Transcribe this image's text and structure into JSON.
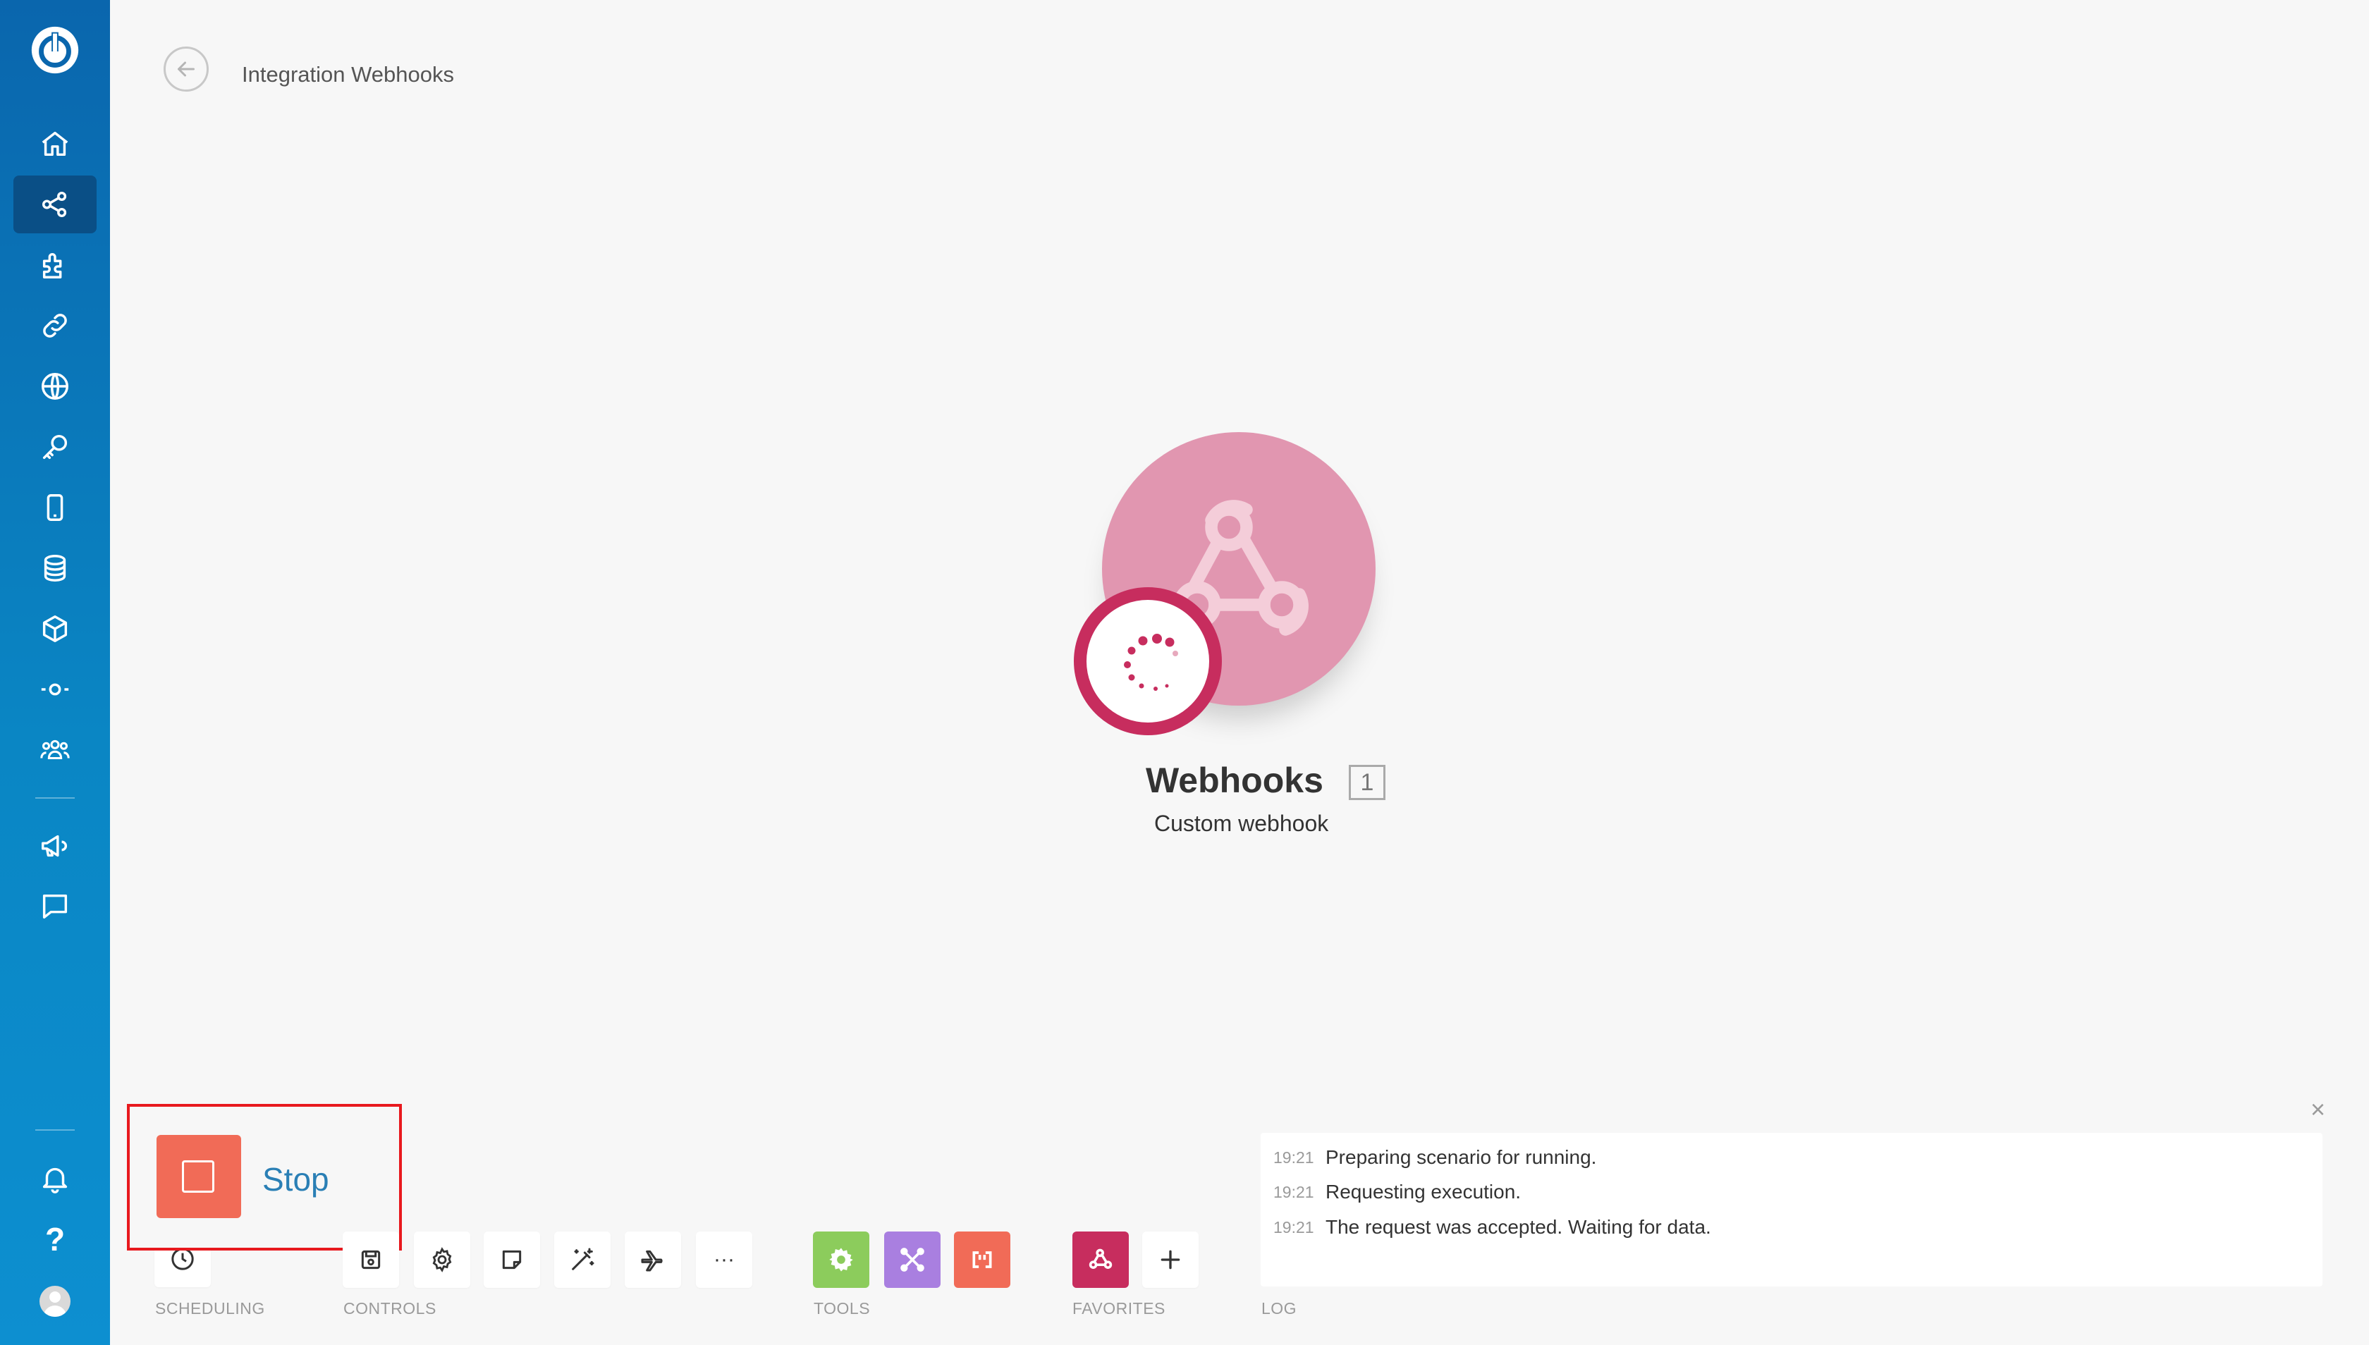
{
  "header": {
    "title": "Integration Webhooks"
  },
  "module": {
    "name": "Webhooks",
    "count": "1",
    "subtitle": "Custom webhook",
    "color": "#e196b0",
    "indicator_color": "#c72d5e"
  },
  "sidebar": {
    "background": "#0a86c4",
    "items": [
      {
        "icon": "home-icon"
      },
      {
        "icon": "scenarios-icon",
        "active": true
      },
      {
        "icon": "templates-icon"
      },
      {
        "icon": "connections-icon"
      },
      {
        "icon": "webhooks-globe-icon"
      },
      {
        "icon": "keys-icon"
      },
      {
        "icon": "devices-icon"
      },
      {
        "icon": "data-stores-icon"
      },
      {
        "icon": "data-structures-icon"
      },
      {
        "icon": "flow-control-icon"
      },
      {
        "icon": "team-icon"
      },
      {
        "icon": "announcements-icon"
      },
      {
        "icon": "chat-icon"
      },
      {
        "icon": "notifications-icon"
      },
      {
        "icon": "help-icon"
      },
      {
        "icon": "avatar"
      }
    ]
  },
  "toolbar": {
    "stop_label": "Stop",
    "stop_color": "#f16b57",
    "scheduling_label": "SCHEDULING",
    "controls_label": "CONTROLS",
    "tools_label": "TOOLS",
    "favorites_label": "FAVORITES",
    "log_label": "LOG",
    "more_label": "···",
    "help_label": "?"
  },
  "log": {
    "close_label": "×",
    "entries": [
      {
        "time": "19:21",
        "text": "Preparing scenario for running."
      },
      {
        "time": "19:21",
        "text": "Requesting execution."
      },
      {
        "time": "19:21",
        "text": "The request was accepted. Waiting for data."
      }
    ]
  }
}
